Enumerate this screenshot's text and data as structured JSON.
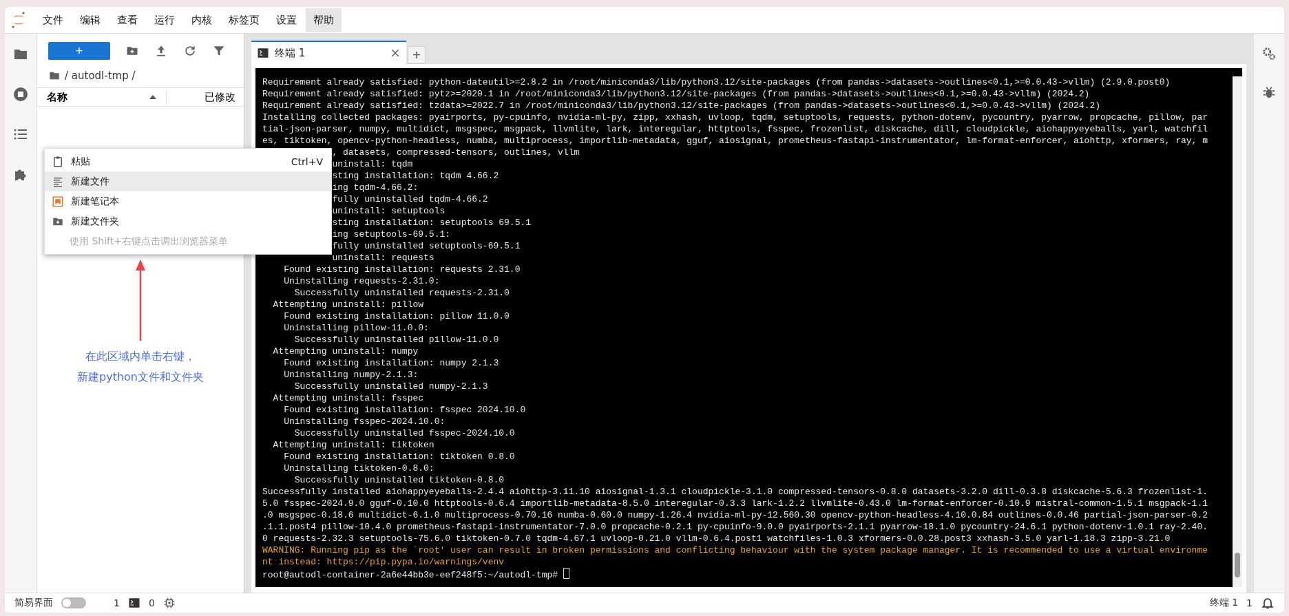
{
  "menubar": {
    "items": [
      {
        "label": "文件",
        "selected": false
      },
      {
        "label": "编辑",
        "selected": false
      },
      {
        "label": "查看",
        "selected": false
      },
      {
        "label": "运行",
        "selected": false
      },
      {
        "label": "内核",
        "selected": false
      },
      {
        "label": "标签页",
        "selected": false
      },
      {
        "label": "设置",
        "selected": false
      },
      {
        "label": "帮助",
        "selected": true
      }
    ]
  },
  "file_browser": {
    "new_button": "+",
    "path": "/ autodl-tmp /",
    "columns": [
      {
        "label": "名称"
      },
      {
        "label": "已修改"
      }
    ]
  },
  "context_menu": {
    "items": [
      {
        "kind": "paste",
        "label": "粘贴",
        "shortcut": "Ctrl+V",
        "selected": false
      },
      {
        "kind": "file",
        "label": "新建文件",
        "selected": true
      },
      {
        "kind": "notebook",
        "label": "新建笔记本",
        "selected": false
      },
      {
        "kind": "folder",
        "label": "新建文件夹",
        "selected": false
      },
      {
        "kind": "hint",
        "label": "使用 Shift+右键点击调出浏览器菜单",
        "selected": false
      }
    ]
  },
  "annotation": {
    "lines": [
      "在此区域内单击右键，",
      "新建python文件和文件夹"
    ]
  },
  "tabs": [
    {
      "label": "终端 1",
      "selected": true
    }
  ],
  "add_tab": "+",
  "terminal": {
    "lines": [
      {
        "kind": "output",
        "covered": false,
        "text": "Requirement already satisfied: python-dateutil>=2.8.2 in /root/miniconda3/lib/python3.12/site-packages (from pandas->datasets->outlines<0.1,>=0.0.43->vllm) (2.9.0.post0)"
      },
      {
        "kind": "output",
        "covered": false,
        "text": "Requirement already satisfied: pytz>=2020.1 in /root/miniconda3/lib/python3.12/site-packages (from pandas->datasets->outlines<0.1,>=0.0.43->vllm) (2024.2)"
      },
      {
        "kind": "output",
        "covered": false,
        "text": "Requirement already satisfied: tzdata>=2022.7 in /root/miniconda3/lib/python3.12/site-packages (from pandas->datasets->outlines<0.1,>=0.0.43->vllm) (2024.2)"
      },
      {
        "kind": "output",
        "covered": false,
        "text": "Installing collected packages: pyairports, py-cpuinfo, nvidia-ml-py, zipp, xxhash, uvloop, tqdm, setuptools, requests, python-dotenv, pycountry, pyarrow, propcache, pillow, par"
      },
      {
        "kind": "output",
        "covered": false,
        "text": "tial-json-parser, numpy, multidict, msgspec, msgpack, llvmlite, lark, interegular, httptools, fsspec, frozenlist, diskcache, dill, cloudpickle, aiohappyeyeballs, yarl, watchfil"
      },
      {
        "kind": "output",
        "covered": false,
        "text": "es, tiktoken, opencv-python-headless, numba, multiprocess, importlib-metadata, gguf, aiosignal, prometheus-fastapi-instrumentator, lm-format-enforcer, aiohttp, xformers, ray, m"
      },
      {
        "kind": "output",
        "covered": true,
        "text": ", datasets, compressed-tensors, outlines, vllm"
      },
      {
        "kind": "output",
        "covered": true,
        "text": "uninstall: tqdm"
      },
      {
        "kind": "output",
        "covered": true,
        "text": "sting installation: tqdm 4.66.2"
      },
      {
        "kind": "output",
        "covered": true,
        "text": "ing tqdm-4.66.2:"
      },
      {
        "kind": "output",
        "covered": true,
        "text": "fully uninstalled tqdm-4.66.2"
      },
      {
        "kind": "output",
        "covered": true,
        "text": "uninstall: setuptools"
      },
      {
        "kind": "output",
        "covered": true,
        "text": "sting installation: setuptools 69.5.1"
      },
      {
        "kind": "output",
        "covered": true,
        "text": "ing setuptools-69.5.1:"
      },
      {
        "kind": "output",
        "covered": true,
        "text": "fully uninstalled setuptools-69.5.1"
      },
      {
        "kind": "output",
        "covered": true,
        "text": "uninstall: requests"
      },
      {
        "kind": "output",
        "covered": false,
        "text": "    Found existing installation: requests 2.31.0"
      },
      {
        "kind": "output",
        "covered": false,
        "text": "    Uninstalling requests-2.31.0:"
      },
      {
        "kind": "output",
        "covered": false,
        "text": "      Successfully uninstalled requests-2.31.0"
      },
      {
        "kind": "output",
        "covered": false,
        "text": "  Attempting uninstall: pillow"
      },
      {
        "kind": "output",
        "covered": false,
        "text": "    Found existing installation: pillow 11.0.0"
      },
      {
        "kind": "output",
        "covered": false,
        "text": "    Uninstalling pillow-11.0.0:"
      },
      {
        "kind": "output",
        "covered": false,
        "text": "      Successfully uninstalled pillow-11.0.0"
      },
      {
        "kind": "output",
        "covered": false,
        "text": "  Attempting uninstall: numpy"
      },
      {
        "kind": "output",
        "covered": false,
        "text": "    Found existing installation: numpy 2.1.3"
      },
      {
        "kind": "output",
        "covered": false,
        "text": "    Uninstalling numpy-2.1.3:"
      },
      {
        "kind": "output",
        "covered": false,
        "text": "      Successfully uninstalled numpy-2.1.3"
      },
      {
        "kind": "output",
        "covered": false,
        "text": "  Attempting uninstall: fsspec"
      },
      {
        "kind": "output",
        "covered": false,
        "text": "    Found existing installation: fsspec 2024.10.0"
      },
      {
        "kind": "output",
        "covered": false,
        "text": "    Uninstalling fsspec-2024.10.0:"
      },
      {
        "kind": "output",
        "covered": false,
        "text": "      Successfully uninstalled fsspec-2024.10.0"
      },
      {
        "kind": "output",
        "covered": false,
        "text": "  Attempting uninstall: tiktoken"
      },
      {
        "kind": "output",
        "covered": false,
        "text": "    Found existing installation: tiktoken 0.8.0"
      },
      {
        "kind": "output",
        "covered": false,
        "text": "    Uninstalling tiktoken-0.8.0:"
      },
      {
        "kind": "output",
        "covered": false,
        "text": "      Successfully uninstalled tiktoken-0.8.0"
      },
      {
        "kind": "output",
        "covered": false,
        "text": "Successfully installed aiohappyeyeballs-2.4.4 aiohttp-3.11.10 aiosignal-1.3.1 cloudpickle-3.1.0 compressed-tensors-0.8.0 datasets-3.2.0 dill-0.3.8 diskcache-5.6.3 frozenlist-1."
      },
      {
        "kind": "output",
        "covered": false,
        "text": "5.0 fsspec-2024.9.0 gguf-0.10.0 httptools-0.6.4 importlib-metadata-8.5.0 interegular-0.3.3 lark-1.2.2 llvmlite-0.43.0 lm-format-enforcer-0.10.9 mistral-common-1.5.1 msgpack-1.1"
      },
      {
        "kind": "output",
        "covered": false,
        "text": ".0 msgspec-0.18.6 multidict-6.1.0 multiprocess-0.70.16 numba-0.60.0 numpy-1.26.4 nvidia-ml-py-12.560.30 opencv-python-headless-4.10.0.84 outlines-0.0.46 partial-json-parser-0.2"
      },
      {
        "kind": "output",
        "covered": false,
        "text": ".1.1.post4 pillow-10.4.0 prometheus-fastapi-instrumentator-7.0.0 propcache-0.2.1 py-cpuinfo-9.0.0 pyairports-2.1.1 pyarrow-18.1.0 pycountry-24.6.1 python-dotenv-1.0.1 ray-2.40."
      },
      {
        "kind": "output",
        "covered": false,
        "text": "0 requests-2.32.3 setuptools-75.6.0 tiktoken-0.7.0 tqdm-4.67.1 uvloop-0.21.0 vllm-0.6.4.post1 watchfiles-1.0.3 xformers-0.0.28.post3 xxhash-3.5.0 yarl-1.18.3 zipp-3.21.0"
      },
      {
        "kind": "warning",
        "covered": false,
        "text": "WARNING: Running pip as the `root' user can result in broken permissions and conflicting behaviour with the system package manager. It is recommended to use a virtual environme"
      },
      {
        "kind": "warning",
        "covered": false,
        "text": "nt instead: https://pip.pypa.io/warnings/venv"
      },
      {
        "kind": "prompt",
        "covered": false,
        "text": "root@autodl-container-2a6e44bb3e-eef248f5:~/autodl-tmp#"
      }
    ]
  },
  "status_bar": {
    "simple_mode": {
      "label": "简易界面",
      "on": false
    },
    "terminals": "1",
    "kernels": "0",
    "right_label": "终端 1",
    "notifications": "1"
  }
}
